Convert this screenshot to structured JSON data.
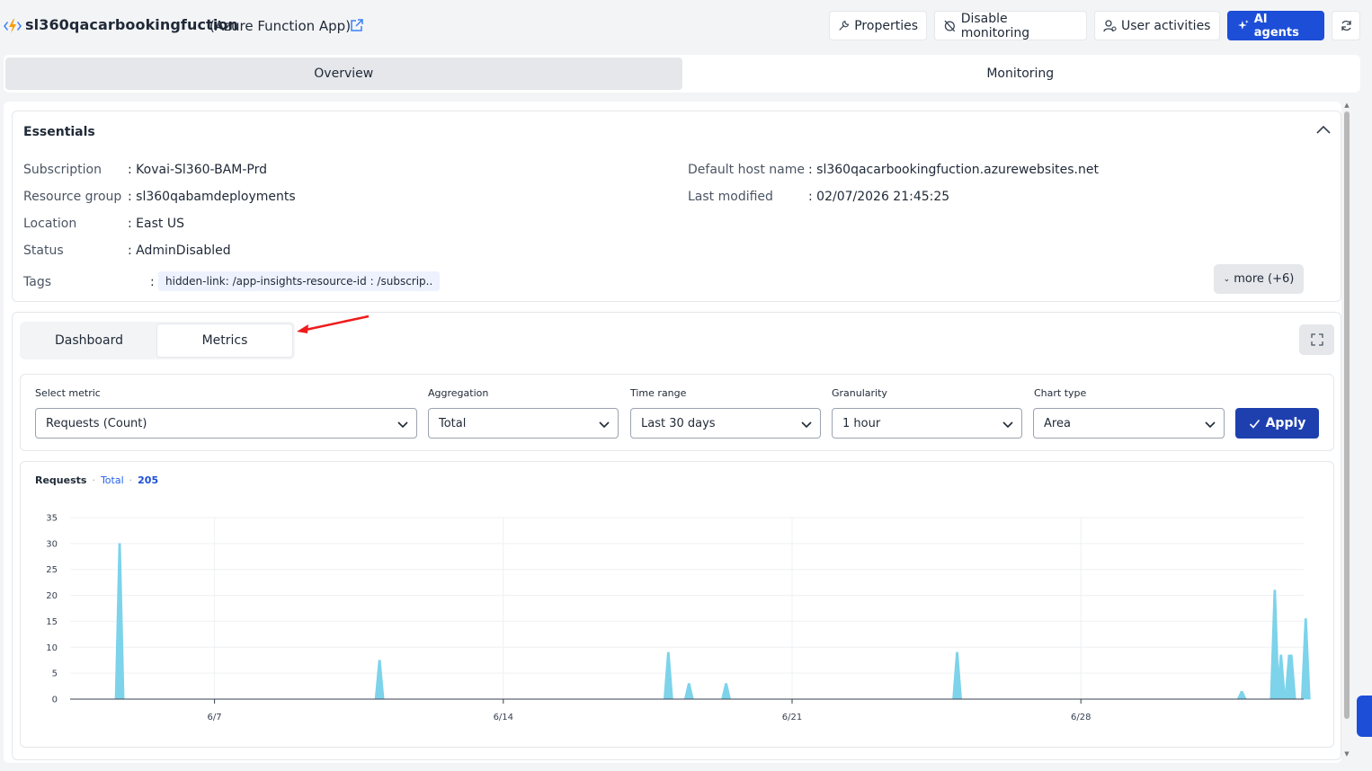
{
  "header": {
    "app_name": "sl360qacarbookingfuction",
    "app_type": "(Azure Function App)",
    "buttons": {
      "properties": "Properties",
      "disable_monitoring": "Disable monitoring",
      "user_activities": "User activities",
      "ai_agents": "AI agents"
    }
  },
  "main_tabs": [
    {
      "label": "Overview",
      "active": true
    },
    {
      "label": "Monitoring",
      "active": false
    }
  ],
  "essentials": {
    "title": "Essentials",
    "left_fields": [
      {
        "label": "Subscription",
        "value": ": Kovai-Sl360-BAM-Prd"
      },
      {
        "label": "Resource group",
        "value": ": sl360qabamdeployments"
      },
      {
        "label": "Location",
        "value": ": East US"
      },
      {
        "label": "Status",
        "value": ": AdminDisabled"
      }
    ],
    "right_fields": [
      {
        "label": "Default host name",
        "value": ": sl360qacarbookingfuction.azurewebsites.net"
      },
      {
        "label": "Last modified",
        "value": ": 02/07/2026 21:45:25"
      }
    ],
    "tags_label": "Tags",
    "tags_sep": ":",
    "tag_chip": "hidden-link: /app-insights-resource-id : /subscrip..",
    "more_label": "more (+6)"
  },
  "sub_tabs": [
    {
      "label": "Dashboard",
      "active": false
    },
    {
      "label": "Metrics",
      "active": true
    }
  ],
  "filters": {
    "select_metric": {
      "label": "Select metric",
      "value": "Requests (Count)"
    },
    "aggregation": {
      "label": "Aggregation",
      "value": "Total"
    },
    "time_range": {
      "label": "Time range",
      "value": "Last 30 days"
    },
    "granularity": {
      "label": "Granularity",
      "value": "1 hour"
    },
    "chart_type": {
      "label": "Chart type",
      "value": "Area"
    },
    "apply_label": "Apply"
  },
  "chart_header": {
    "metric": "Requests",
    "sep": "·",
    "aggregation": "Total",
    "total": "205"
  },
  "colors": {
    "accent": "#1d4ed8",
    "area_fill": "#7dd3ea"
  },
  "chart_data": {
    "type": "area",
    "xlabel": "",
    "ylabel": "",
    "ylim": [
      0,
      35
    ],
    "y_ticks": [
      0,
      5,
      10,
      15,
      20,
      25,
      30,
      35
    ],
    "x_ticks": [
      "6/7",
      "6/14",
      "6/21",
      "6/28"
    ],
    "x_tick_days": [
      7,
      14,
      21,
      28
    ],
    "x_range_days": [
      3.5,
      33.4
    ],
    "grid": true,
    "series": [
      {
        "values": [
          {
            "day": 4.7,
            "value": 30
          },
          {
            "day": 11.0,
            "value": 7.5
          },
          {
            "day": 18.0,
            "value": 9
          },
          {
            "day": 18.5,
            "value": 3
          },
          {
            "day": 19.4,
            "value": 3
          },
          {
            "day": 25.0,
            "value": 9
          },
          {
            "day": 31.9,
            "value": 1.5
          },
          {
            "day": 32.7,
            "value": 21
          },
          {
            "day": 32.85,
            "value": 8.5
          },
          {
            "day": 33.0,
            "value": 2
          },
          {
            "day": 33.05,
            "value": 8.5
          },
          {
            "day": 33.1,
            "value": 2
          },
          {
            "day": 33.1,
            "value": 8.5
          },
          {
            "day": 33.45,
            "value": 15.5
          }
        ]
      }
    ]
  }
}
